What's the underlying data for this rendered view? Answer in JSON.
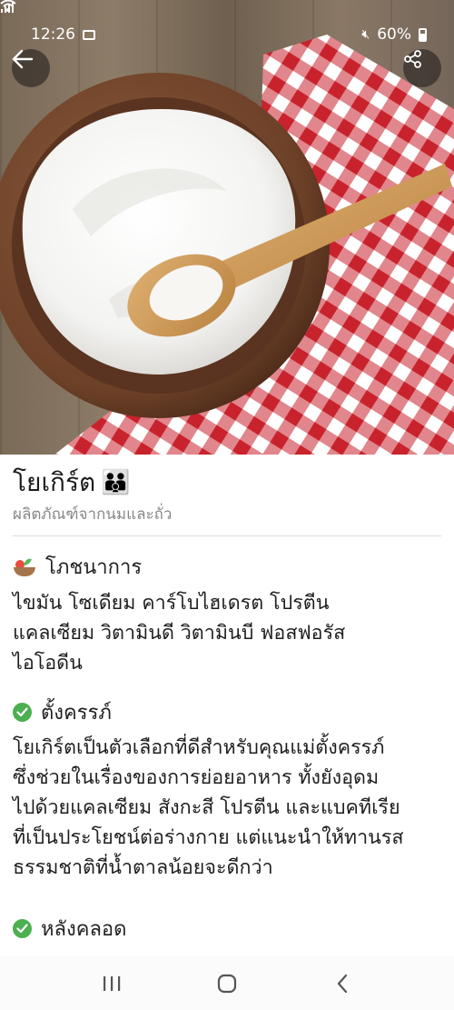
{
  "status_bar": {
    "time": "12:26",
    "battery": "60%"
  },
  "hero": {
    "icons": [
      "back-arrow-icon",
      "share-icon"
    ]
  },
  "food": {
    "name": "โยเกิร์ต",
    "category": "ผลิตภัณฑ์จากนมและถั่ว"
  },
  "sections": {
    "nutrition": {
      "title": "โภชนาการ",
      "lines": [
        "ไขมัน โซเดียม คาร์โบไฮเดรต โปรตีน",
        "แคลเซียม วิตามินดี วิตามินบี ฟอสฟอรัส",
        "ไอโอดีน"
      ]
    },
    "pregnant": {
      "title": "ตั้งครรภ์",
      "lines": [
        "โยเกิร์ตเป็นตัวเลือกที่ดีสำหรับคุณแม่ตั้งครรภ์",
        "ซึ่งช่วยในเรื่องของการย่อยอาหาร ทั้งยังอุดม",
        "ไปด้วยแคลเซียม สังกะสี โปรตีน และแบคทีเรีย",
        "ที่เป็นประโยชน์ต่อร่างกาย แต่แนะนำให้ทานรส",
        "ธรรมชาติที่น้ำตาลน้อยจะดีกว่า"
      ]
    },
    "postpartum": {
      "title": "หลังคลอด"
    }
  },
  "colors": {
    "check_green": "#4caf50",
    "checker_red": "#c8232d"
  },
  "nav_icons": [
    "recent-apps-icon",
    "home-icon",
    "back-icon"
  ]
}
